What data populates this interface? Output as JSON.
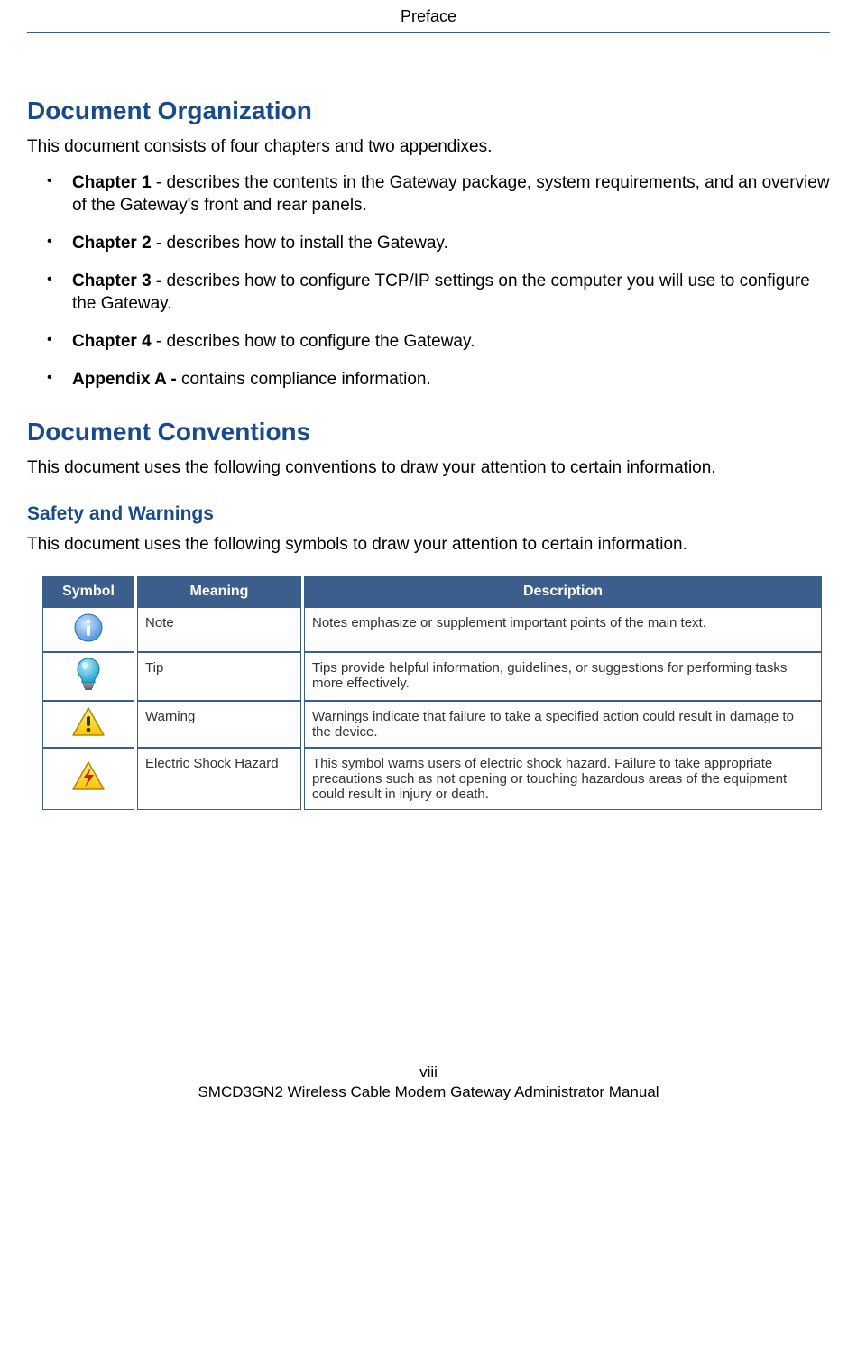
{
  "header": {
    "title": "Preface"
  },
  "sections": {
    "org": {
      "heading": "Document Organization",
      "intro": "This document consists of four chapters and two appendixes.",
      "items": [
        {
          "bold": "Chapter 1",
          "text": " - describes the contents in the Gateway package, system requirements, and an overview of the Gateway's front and rear panels."
        },
        {
          "bold": "Chapter 2",
          "text": " - describes how to install the Gateway."
        },
        {
          "bold": "Chapter 3 -",
          "text": " describes how to configure TCP/IP settings on the computer you will use to configure the Gateway."
        },
        {
          "bold": "Chapter 4",
          "text": " - describes how to configure the Gateway."
        },
        {
          "bold": "Appendix A -",
          "text": " contains compliance information."
        }
      ]
    },
    "conv": {
      "heading": "Document Conventions",
      "intro": "This document uses the following conventions to draw your attention to certain information."
    },
    "safety": {
      "heading": "Safety and Warnings",
      "intro": "This document uses the following symbols to draw your attention to certain information."
    }
  },
  "table": {
    "headers": {
      "symbol": "Symbol",
      "meaning": "Meaning",
      "description": "Description"
    },
    "rows": [
      {
        "icon": "info",
        "meaning": "Note",
        "description": "Notes emphasize or supplement important points of the main text."
      },
      {
        "icon": "tip",
        "meaning": "Tip",
        "description": "Tips provide helpful information, guidelines, or suggestions for performing tasks more effectively."
      },
      {
        "icon": "warning",
        "meaning": "Warning",
        "description": "Warnings indicate that failure to take a specified action could result in damage to the device."
      },
      {
        "icon": "shock",
        "meaning": "Electric Shock Hazard",
        "description": "This symbol warns users of electric shock hazard. Failure to take appropriate precautions such as not opening or touching hazardous areas of the equipment could result in injury or death."
      }
    ]
  },
  "footer": {
    "page": "viii",
    "manual": "SMCD3GN2 Wireless Cable Modem Gateway Administrator Manual"
  }
}
